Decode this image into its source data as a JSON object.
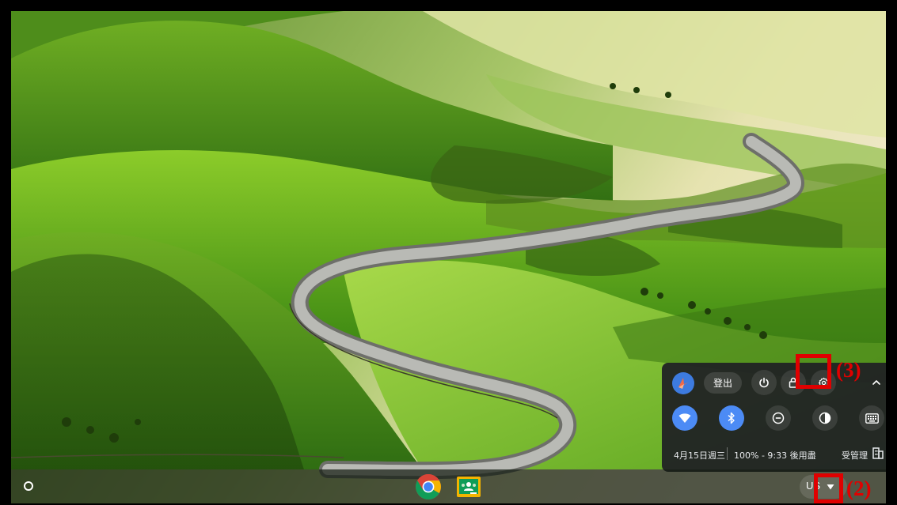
{
  "shelf": {
    "launcher_icon": "launcher-circle-icon",
    "apps": [
      {
        "name": "chrome-icon"
      },
      {
        "name": "google-classroom-icon"
      }
    ],
    "ime_label": "US",
    "tray_icon": "tray-arrow-icon"
  },
  "quick_settings": {
    "sign_out_label": "登出",
    "top_icons": [
      "avatar-icon",
      "power-icon",
      "lock-icon",
      "settings-icon",
      "collapse-chevron-icon"
    ],
    "feature_icons": [
      "wifi-icon",
      "bluetooth-icon",
      "do-not-disturb-icon",
      "night-light-icon",
      "keyboard-icon"
    ],
    "date": "4月15日週三",
    "battery": "100% - 9:33 後用盡",
    "managed": "受管理"
  },
  "annotations": {
    "settings_label": "(3)",
    "tray_label": "(2)"
  },
  "colors": {
    "accent_blue": "#4c8bf5",
    "annotation_red": "#e00000"
  }
}
